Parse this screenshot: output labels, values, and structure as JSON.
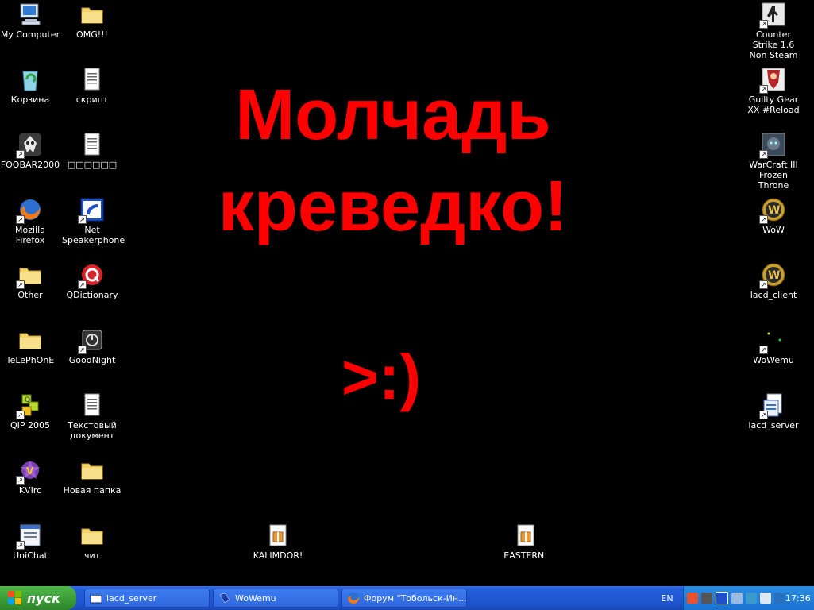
{
  "wallpaper": {
    "line1": "Молчадь",
    "line2": "креведко!",
    "smile": ">:)"
  },
  "desktop_icons_left": [
    {
      "label": "My Computer",
      "icon": "computer-icon"
    },
    {
      "label": "Корзина",
      "icon": "recycle-bin-icon"
    },
    {
      "label": "FOOBAR2000",
      "icon": "foobar-icon"
    },
    {
      "label": "Mozilla Firefox",
      "icon": "firefox-icon"
    },
    {
      "label": "Other",
      "icon": "folder-icon"
    },
    {
      "label": "TeLePhOnE",
      "icon": "folder-icon"
    },
    {
      "label": "QIP 2005",
      "icon": "qip-icon"
    },
    {
      "label": "KVIrc",
      "icon": "kvirc-icon"
    },
    {
      "label": "UniChat",
      "icon": "unichat-icon"
    }
  ],
  "desktop_icons_left2": [
    {
      "label": "OMG!!!",
      "icon": "folder-icon"
    },
    {
      "label": "скрипт",
      "icon": "text-document-icon"
    },
    {
      "label": "□□□□□□",
      "icon": "text-document-icon"
    },
    {
      "label": "Net Speakerphone",
      "icon": "net-speakerphone-icon"
    },
    {
      "label": "QDictionary",
      "icon": "qdictionary-icon"
    },
    {
      "label": "GoodNight",
      "icon": "goodnight-icon"
    },
    {
      "label": "Текстовый документ",
      "icon": "text-document-icon"
    },
    {
      "label": "Новая папка",
      "icon": "folder-icon"
    },
    {
      "label": "чит",
      "icon": "folder-icon"
    }
  ],
  "desktop_icons_bottom": [
    {
      "label": "KALIMDOR!",
      "icon": "archive-icon"
    },
    {
      "label": "EASTERN!",
      "icon": "archive-icon"
    }
  ],
  "desktop_icons_right": [
    {
      "label": "Counter Strike 1.6 Non Steam",
      "icon": "counter-strike-icon"
    },
    {
      "label": "Guilty Gear XX #Reload",
      "icon": "guilty-gear-icon"
    },
    {
      "label": "WarCraft III Frozen Throne",
      "icon": "warcraft-icon"
    },
    {
      "label": "WoW",
      "icon": "wow-icon"
    },
    {
      "label": "lacd_client",
      "icon": "wow-icon"
    },
    {
      "label": "WoWemu",
      "icon": "wowemu-icon"
    },
    {
      "label": "lacd_server",
      "icon": "server-icon"
    }
  ],
  "taskbar": {
    "start_label": "пуск",
    "tasks": [
      {
        "label": "lacd_server",
        "icon": "window-icon"
      },
      {
        "label": "WoWemu",
        "icon": "wowemu-icon"
      },
      {
        "label": "Форум \"Тобольск-Ин...",
        "icon": "firefox-icon"
      }
    ],
    "language": "EN",
    "clock": "17:36"
  },
  "colors": {
    "wallpaper_text": "#ff0000",
    "desktop_bg": "#000000",
    "taskbar_blue": "#245edb",
    "start_green": "#3a9a35"
  }
}
